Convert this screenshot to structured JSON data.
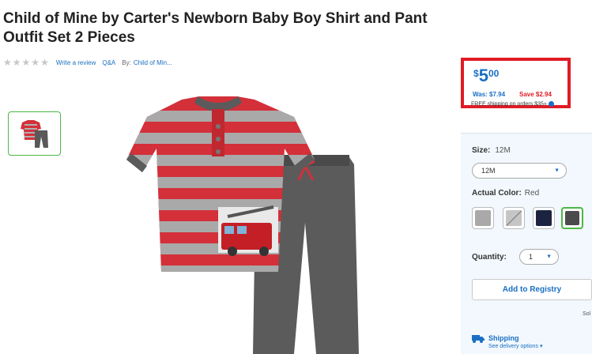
{
  "product": {
    "title": "Child of Mine by Carter's Newborn Baby Boy Shirt and Pant Outfit Set 2 Pieces",
    "rating_stars": 0,
    "write_review": "Write a review",
    "qa": "Q&A",
    "by_label": "By:",
    "brand": "Child of Min..."
  },
  "pricing": {
    "currency": "$",
    "dollars": "5",
    "cents": "00",
    "was": "Was: $7.94",
    "save": "Save $2.94",
    "free_shipping": "FREE shipping on orders $35+"
  },
  "options": {
    "size_label": "Size:",
    "size_value": "12M",
    "size_selected": "12M",
    "color_label": "Actual Color:",
    "color_value": "Red",
    "swatches": [
      {
        "name": "Gray",
        "color": "#a9a9a9",
        "unavailable": false,
        "selected": false
      },
      {
        "name": "Heather Gray",
        "color": "#c5c5c5",
        "unavailable": true,
        "selected": false
      },
      {
        "name": "Navy",
        "color": "#1c2340",
        "unavailable": false,
        "selected": false
      },
      {
        "name": "Red",
        "color": "#4b4b4b",
        "unavailable": false,
        "selected": true
      }
    ],
    "quantity_label": "Quantity:",
    "quantity_value": "1"
  },
  "actions": {
    "add_to_registry": "Add to Registry",
    "sold_by": "Sol"
  },
  "shipping": {
    "title": "Shipping",
    "subtitle": "See delivery options"
  },
  "colors": {
    "accent_blue": "#1a6fc4",
    "sale_red": "#e01b24",
    "selected_green": "#4cb845"
  }
}
